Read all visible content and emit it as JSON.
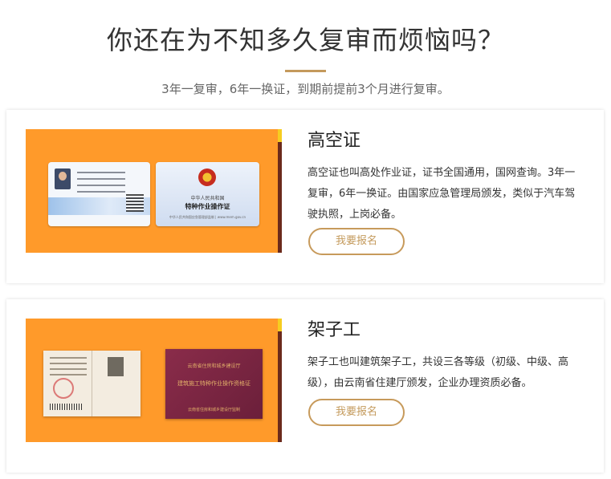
{
  "header": {
    "title": "你还在为不知多久复审而烦恼吗？",
    "subtitle": "3年一复审，6年一换证，到期前提前3个月进行复审。"
  },
  "colors": {
    "accent": "#c49a5c",
    "image_bg": "#ff9a2a"
  },
  "courses": [
    {
      "title": "高空证",
      "description": "高空证也叫高处作业证，证书全国通用，国网查询。3年一复审，6年一换证。由国家应急管理局颁发，类似于汽车驾驶执照，上岗必备。",
      "button": "我要报名",
      "image": {
        "cert_header": "中华人民共和国",
        "cert_title": "特种作业操作证",
        "cert_footer": "中华人民共和国应急管理部监制 | www.mem.gov.cn"
      }
    },
    {
      "title": "架子工",
      "description": "架子工也叫建筑架子工，共设三各等级（初级、中级、高级），由云南省住建厅颁发，企业办理资质必备。",
      "button": "我要报名",
      "image": {
        "book_header": "云南省住房和城乡建设厅",
        "book_title": "建筑施工特种作业操作资格证",
        "book_footer": "云南省住房和城乡建设厅监制"
      }
    }
  ]
}
